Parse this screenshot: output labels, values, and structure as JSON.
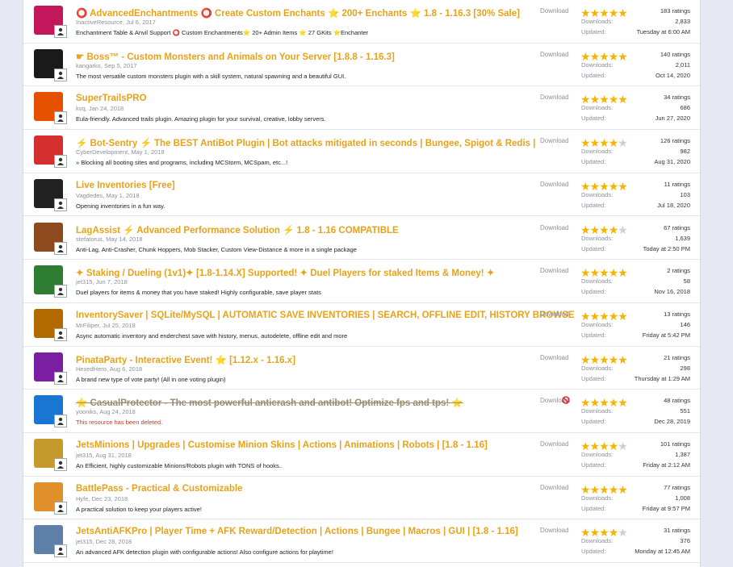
{
  "download_label": "Download",
  "downloads_label": "Downloads:",
  "updated_label": "Updated:",
  "resources": [
    {
      "title": "⭕ AdvancedEnchantments ⭕ Create Custom Enchants ⭐ 200+ Enchants ⭐ 1.8 - 1.16.3 [30% Sale]",
      "author": "InactiveResource",
      "date": "Jul 6, 2017",
      "description": "Enchantment Table & Anvil Support ⭕ Custom Enchantments⭐ 20+ Admin Items ⭐ 27 GKits ⭐Enchanter",
      "rating": 4.5,
      "ratings": "183 ratings",
      "downloads": "2,833",
      "updated": "Tuesday at 6:00 AM",
      "deleted": false,
      "thumb_color": "#c2185b"
    },
    {
      "title": "☛ Boss™ - Custom Monsters and Animals on Your Server [1.8.8 - 1.16.3]",
      "author": "kangarko",
      "date": "Sep 5, 2017",
      "description": "The most versatile custom monsters plugin with a skill system, natural spawning and a beautiful GUI.",
      "rating": 4.5,
      "ratings": "140 ratings",
      "downloads": "2,011",
      "updated": "Oct 14, 2020",
      "deleted": false,
      "thumb_color": "#1a1a1a"
    },
    {
      "title": "SuperTrailsPRO",
      "author": "kvq",
      "date": "Jan 24, 2018",
      "description": "Eula-friendly. Advanced trails plugin. Amazing plugin for your survival, creative, lobby servers.",
      "rating": 4.5,
      "ratings": "34 ratings",
      "downloads": "686",
      "updated": "Jun 27, 2020",
      "deleted": false,
      "thumb_color": "#e65100"
    },
    {
      "title": "⚡ Bot-Sentry ⚡ The BEST AntiBot Plugin | Bot attacks mitigated in seconds | Bungee, Spigot & Redis |",
      "author": "CyberDevelopment",
      "date": "May 1, 2018",
      "description": "» Blocking all booting sites and programs, including MCStorm, MCSpam, etc...!",
      "rating": 4,
      "ratings": "126 ratings",
      "downloads": "982",
      "updated": "Aug 31, 2020",
      "deleted": false,
      "thumb_color": "#d32f2f"
    },
    {
      "title": "Live Inventories [Free]",
      "author": "Vagdedes",
      "date": "May 1, 2018",
      "description": "Opening inventories in a fun way.",
      "rating": 5,
      "ratings": "11 ratings",
      "downloads": "103",
      "updated": "Jul 18, 2020",
      "deleted": false,
      "thumb_color": "#222222"
    },
    {
      "title": "LagAssist ⚡ Advanced Performance Solution ⚡ 1.8 - 1.16 COMPATIBLE",
      "author": "stefatorus",
      "date": "May 14, 2018",
      "description": "Anti-Lag, Anti-Crasher, Chunk Hoppers, Mob Stacker, Custom View-Distance & more in a single package",
      "rating": 4,
      "ratings": "67 ratings",
      "downloads": "1,639",
      "updated": "Today at 2:50 PM",
      "deleted": false,
      "thumb_color": "#8d4a1f"
    },
    {
      "title": "✦ Staking / Dueling (1v1)✦ [1.8-1.14.X] Supported! ✦ Duel Players for staked Items & Money! ✦",
      "author": "jet315",
      "date": "Jun 7, 2018",
      "description": "Duel players for items & money that you have staked! Highly configurable, save player stats",
      "rating": 5,
      "ratings": "2 ratings",
      "downloads": "58",
      "updated": "Nov 16, 2018",
      "deleted": false,
      "thumb_color": "#2e7d32"
    },
    {
      "title": "InventorySaver | SQLite/MySQL | AUTOMATIC SAVE INVENTORIES | SEARCH, OFFLINE EDIT, HISTORY BROWSE",
      "author": "MrFiliper",
      "date": "Jul 25, 2018",
      "description": "Async automatic inventory and enderchest save with history, menus, autodelete, offline edit and more",
      "rating": 4.5,
      "ratings": "13 ratings",
      "downloads": "146",
      "updated": "Friday at 5:42 PM",
      "deleted": false,
      "thumb_color": "#b26a00"
    },
    {
      "title": "PinataParty - Interactive Event! ⭐ [1.12.x - 1.16.x]",
      "author": "HexedHero",
      "date": "Aug 6, 2018",
      "description": "A brand new type of vote party! (All in one voting plugin)",
      "rating": 5,
      "ratings": "21 ratings",
      "downloads": "298",
      "updated": "Thursday at 1:29 AM",
      "deleted": false,
      "thumb_color": "#7b1fa2"
    },
    {
      "title": "⭐ CasualProtector - The most powerful anticrash and antibot! Optimize fps and tps! ⭐",
      "author": "yooniks",
      "date": "Aug 24, 2018",
      "description": "This resource has been deleted.",
      "rating": 4.5,
      "ratings": "48 ratings",
      "downloads": "551",
      "updated": "Dec 28, 2019",
      "deleted": true,
      "thumb_color": "#1976d2"
    },
    {
      "title": "JetsMinions | Upgrades | Customise Minion Skins | Actions | Animations | Robots | [1.8 - 1.16]",
      "author": "jet315",
      "date": "Aug 31, 2018",
      "description": "An Efficient, highly customizable Minions/Robots plugin with TONS of hooks..",
      "rating": 4,
      "ratings": "101 ratings",
      "downloads": "1,387",
      "updated": "Friday at 2:12 AM",
      "deleted": false,
      "thumb_color": "#c49a2c"
    },
    {
      "title": "BattlePass - Practical & Customizable",
      "author": "Hyfe",
      "date": "Dec 23, 2018",
      "description": "A practical solution to keep your players active!",
      "rating": 4.5,
      "ratings": "77 ratings",
      "downloads": "1,008",
      "updated": "Friday at 9:57 PM",
      "deleted": false,
      "thumb_color": "#e0902a"
    },
    {
      "title": "JetsAntiAFKPro | Player Time + AFK Reward/Detection | Actions | Bungee | Macros | GUI | [1.8 - 1.16]",
      "author": "jet315",
      "date": "Dec 28, 2018",
      "description": "An advanced AFK detection plugin with configurable actions! Also configure actions for playtime!",
      "rating": 4,
      "ratings": "31 ratings",
      "downloads": "376",
      "updated": "Monday at 12:45 AM",
      "deleted": false,
      "thumb_color": "#5d7fa8"
    }
  ]
}
